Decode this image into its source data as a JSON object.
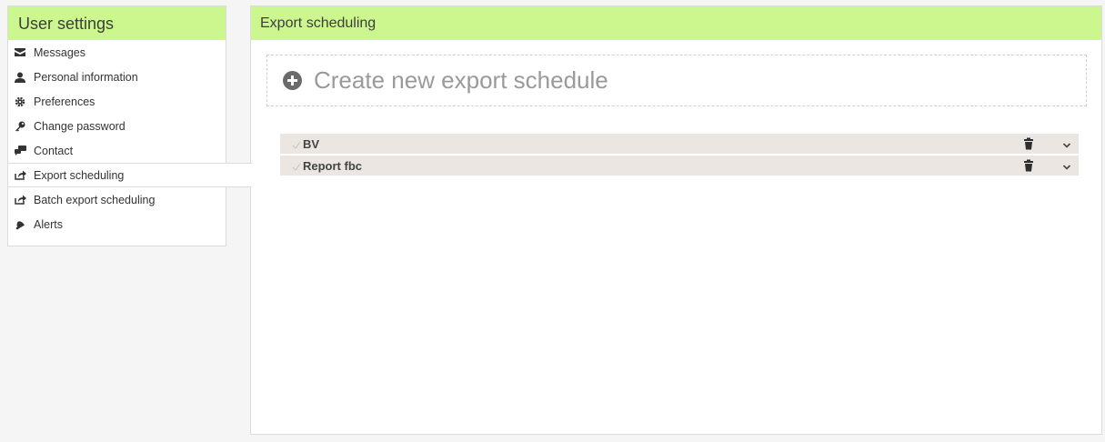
{
  "sidebar": {
    "title": "User settings",
    "items": [
      {
        "label": "Messages",
        "icon": "envelope-icon"
      },
      {
        "label": "Personal information",
        "icon": "user-icon"
      },
      {
        "label": "Preferences",
        "icon": "gear-icon"
      },
      {
        "label": "Change password",
        "icon": "key-icon"
      },
      {
        "label": "Contact",
        "icon": "chat-icon"
      },
      {
        "label": "Export scheduling",
        "icon": "share-icon",
        "active": true
      },
      {
        "label": "Batch export scheduling",
        "icon": "share-icon"
      },
      {
        "label": "Alerts",
        "icon": "bell-icon"
      }
    ]
  },
  "main": {
    "title": "Export scheduling",
    "create_label": "Create new export schedule",
    "schedules": [
      {
        "name": "BV"
      },
      {
        "name": "Report fbc"
      }
    ]
  },
  "colors": {
    "header_bg": "#ccf78f",
    "row_bg": "#ebe6e1"
  }
}
